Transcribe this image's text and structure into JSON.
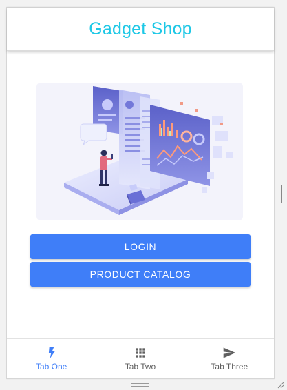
{
  "header": {
    "title": "Gadget Shop"
  },
  "illustration": {
    "name": "dashboard-analytics-illustration"
  },
  "buttons": {
    "login_label": "LOGIN",
    "catalog_label": "PRODUCT CATALOG"
  },
  "tabs": [
    {
      "label": "Tab One",
      "icon": "flash-icon",
      "active": true
    },
    {
      "label": "Tab Two",
      "icon": "apps-grid-icon",
      "active": false
    },
    {
      "label": "Tab Three",
      "icon": "send-icon",
      "active": false
    }
  ],
  "colors": {
    "title": "#1ec8e6",
    "primary": "#3f7ef8",
    "tab_inactive": "#606060"
  }
}
